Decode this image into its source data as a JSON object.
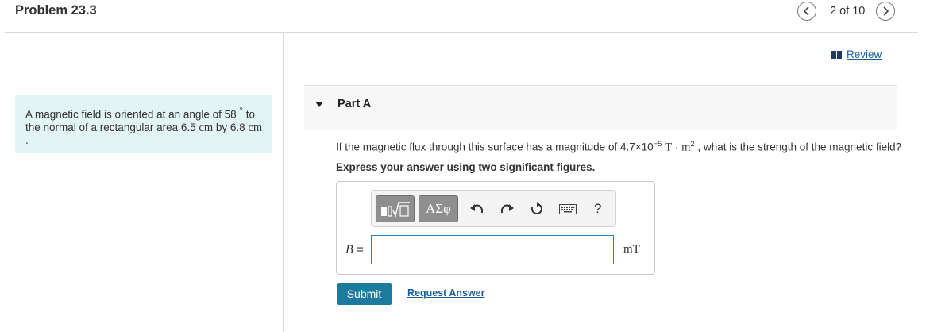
{
  "header": {
    "title": "Problem 23.3",
    "page_count": "2 of 10",
    "prev_icon": "chevron-left-icon",
    "next_icon": "chevron-right-icon"
  },
  "problem": {
    "text_1": "A magnetic field is oriented at an angle of 58",
    "degree": "°",
    "text_2": " to the normal of a rectangular area 6.5",
    "unit_1": "cm",
    "text_3": " by 6.8",
    "unit_2": "cm",
    "text_4": "."
  },
  "review": {
    "label": "Review",
    "icon": "book-icon"
  },
  "part": {
    "label": "Part A",
    "icon": "triangle-down-icon"
  },
  "question": {
    "text_1": "If the magnetic flux through this surface has a magnitude of 4.7×10",
    "exponent": "−5",
    "unit_1": "T",
    "dot": "·",
    "unit_2": "m",
    "unit_exp": "2",
    "text_2": " , what is the strength of the magnetic field?"
  },
  "instruction": "Express your answer using two significant figures.",
  "toolbar": {
    "templates_icon": "templates-icon",
    "symbols_label": "ΑΣφ",
    "undo_icon": "undo-icon",
    "redo_icon": "redo-icon",
    "reset_icon": "reset-icon",
    "keyboard_icon": "keyboard-icon",
    "help_label": "?"
  },
  "answer": {
    "variable": "B",
    "equals": " =",
    "value": "",
    "unit": "mT"
  },
  "actions": {
    "submit_label": "Submit",
    "request_label": "Request Answer"
  },
  "colors": {
    "problem_bg": "#e3f4f4",
    "submit_bg": "#1d7a9c",
    "link": "#1a5e99",
    "input_border": "#2f7fb8"
  }
}
